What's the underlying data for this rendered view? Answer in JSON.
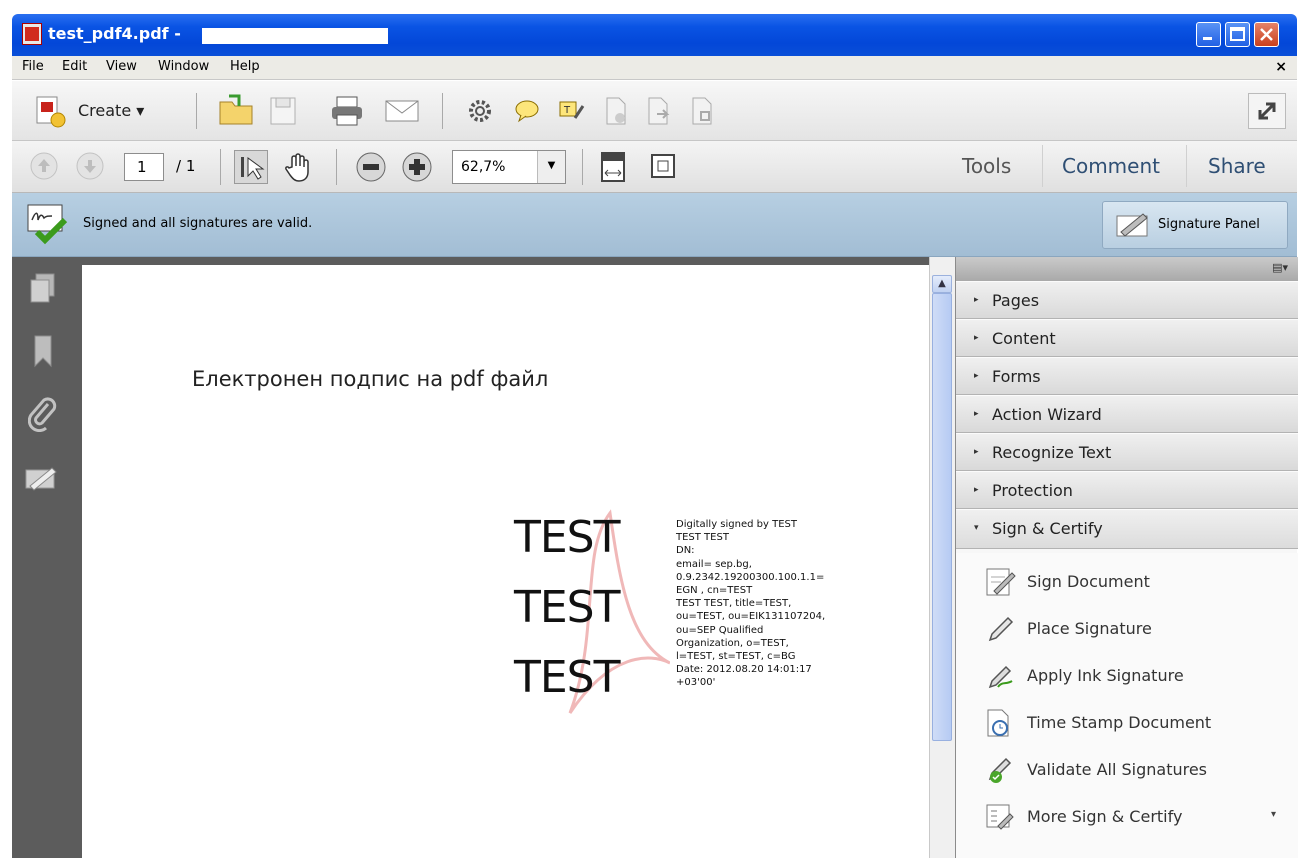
{
  "window": {
    "title": "test_pdf4.pdf -"
  },
  "menu": {
    "items": [
      "File",
      "Edit",
      "View",
      "Window",
      "Help"
    ],
    "close_symbol": "×"
  },
  "toolbar": {
    "create_label": "Create ▾"
  },
  "nav_toolbar": {
    "current_page": "1",
    "page_total": "/ 1",
    "zoom": "62,7%",
    "tools_label": "Tools",
    "comment_label": "Comment",
    "share_label": "Share"
  },
  "signature_bar": {
    "message": "Signed and all signatures are valid.",
    "panel_button": "Signature Panel"
  },
  "document": {
    "heading": "Електронен подпис на pdf файл",
    "signature_names": [
      "TEST",
      "TEST",
      "TEST"
    ],
    "signature_details": [
      "Digitally signed by TEST",
      "TEST TEST",
      "DN:",
      "email=                    sep.bg,",
      "0.9.2342.19200300.100.1.1=",
      "EGN                  , cn=TEST",
      "TEST TEST, title=TEST,",
      "ou=TEST, ou=EIK131107204,",
      "ou=SEP Qualified",
      "Organization, o=TEST,",
      "l=TEST, st=TEST, c=BG",
      "Date: 2012.08.20 14:01:17",
      "+03'00'"
    ]
  },
  "right_panel": {
    "options_symbol": "▤▾",
    "panes": [
      {
        "label": "Pages",
        "arrow": "▸"
      },
      {
        "label": "Content",
        "arrow": "▸"
      },
      {
        "label": "Forms",
        "arrow": "▸"
      },
      {
        "label": "Action Wizard",
        "arrow": "▸"
      },
      {
        "label": "Recognize Text",
        "arrow": "▸"
      },
      {
        "label": "Protection",
        "arrow": "▸"
      },
      {
        "label": "Sign & Certify",
        "arrow": "▾"
      }
    ],
    "tasks": [
      {
        "label": "Sign Document",
        "icon": "sign-document-icon"
      },
      {
        "label": "Place Signature",
        "icon": "pen-icon"
      },
      {
        "label": "Apply Ink Signature",
        "icon": "ink-pen-icon"
      },
      {
        "label": "Time Stamp Document",
        "icon": "clock-document-icon"
      },
      {
        "label": "Validate All Signatures",
        "icon": "validate-pen-icon"
      },
      {
        "label": "More Sign & Certify",
        "icon": "more-certify-icon"
      }
    ],
    "more_arrow": "▾"
  },
  "colors": {
    "titlebar": "#0a54e4",
    "signature_bar": "#afc8dd",
    "nav_background": "#5c5c5c",
    "accent_link": "#2f4f74"
  }
}
